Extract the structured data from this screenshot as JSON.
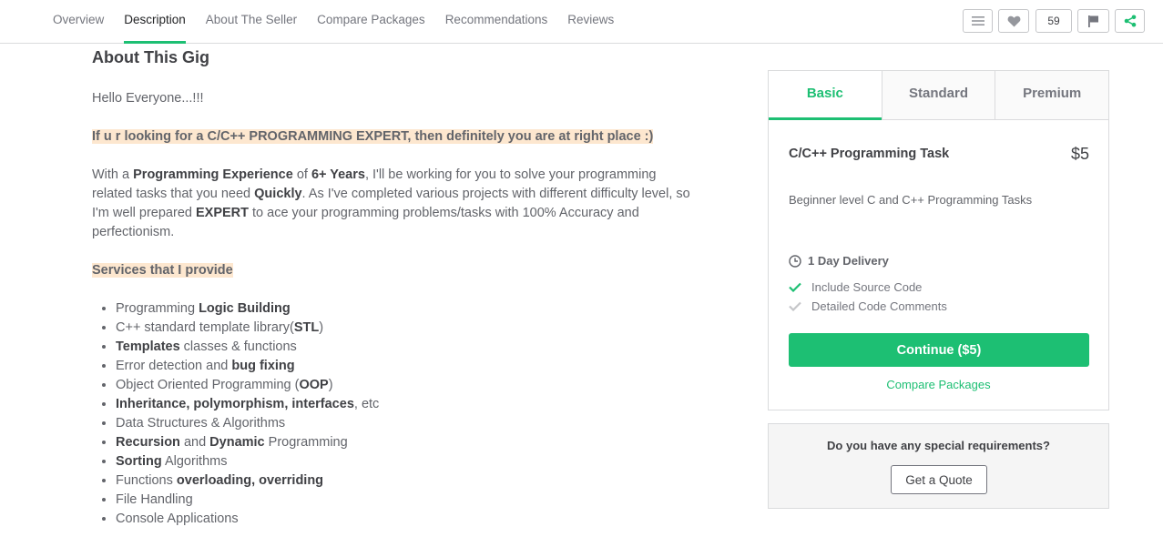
{
  "nav": {
    "tabs": [
      {
        "label": "Overview"
      },
      {
        "label": "Description"
      },
      {
        "label": "About The Seller"
      },
      {
        "label": "Compare Packages"
      },
      {
        "label": "Recommendations"
      },
      {
        "label": "Reviews"
      }
    ],
    "active_tab": "Description",
    "like_count": "59",
    "icons": [
      "menu-icon",
      "heart-icon",
      "flag-icon",
      "share-icon"
    ],
    "share_color": "#1dbf73"
  },
  "gig": {
    "title": "About This Gig",
    "greeting": "Hello Everyone...!!!",
    "highlight": "If u r looking for a C/C++ PROGRAMMING EXPERT, then definitely you are at right place :)",
    "intro": {
      "t1": "With a ",
      "b1": "Programming Experience",
      "t2": " of ",
      "b2": "6+ Years",
      "t3": ", I'll be working for you to solve your programming related tasks that you need ",
      "b3": "Quickly",
      "t4": ". As I've completed various projects with different difficulty level, so I'm well prepared ",
      "b4": "EXPERT",
      "t5": " to ace your programming problems/tasks with 100% Accuracy and perfectionism."
    },
    "services_heading": "Services that I provide",
    "services": {
      "s1": {
        "t": "Programming ",
        "b": "Logic Building"
      },
      "s2": {
        "t": "C++ standard template library(",
        "b": "STL",
        "t2": ")"
      },
      "s3": {
        "b": "Templates",
        "t": " classes & functions"
      },
      "s4": {
        "t": "Error detection and ",
        "b": "bug fixing"
      },
      "s5": {
        "t": "Object Oriented Programming (",
        "b": "OOP",
        "t2": ")"
      },
      "s6": {
        "b": "Inheritance, polymorphism, interfaces",
        "t": ", etc"
      },
      "s7": {
        "t": "Data Structures & Algorithms"
      },
      "s8": {
        "b": "Recursion",
        "t": " and ",
        "b2": "Dynamic",
        "t2": " Programming"
      },
      "s9": {
        "b": "Sorting",
        "t": " Algorithms"
      },
      "s10": {
        "t": "Functions ",
        "b": "overloading, overriding"
      },
      "s11": {
        "t": "File Handling"
      },
      "s12": {
        "t": "Console Applications"
      }
    }
  },
  "package": {
    "tabs": [
      {
        "label": "Basic"
      },
      {
        "label": "Standard"
      },
      {
        "label": "Premium"
      }
    ],
    "active_tab": "Basic",
    "title": "C/C++ Programming Task",
    "price": "$5",
    "description": "Beginner level C and C++ Programming Tasks",
    "delivery": "1 Day Delivery",
    "features": [
      {
        "label": "Include Source Code",
        "included": true
      },
      {
        "label": "Detailed Code Comments",
        "included": false
      }
    ],
    "continue_label": "Continue ($5)",
    "compare_label": "Compare Packages",
    "accent_color": "#1dbf73"
  },
  "quote": {
    "question": "Do you have any special requirements?",
    "button_label": "Get a Quote"
  }
}
